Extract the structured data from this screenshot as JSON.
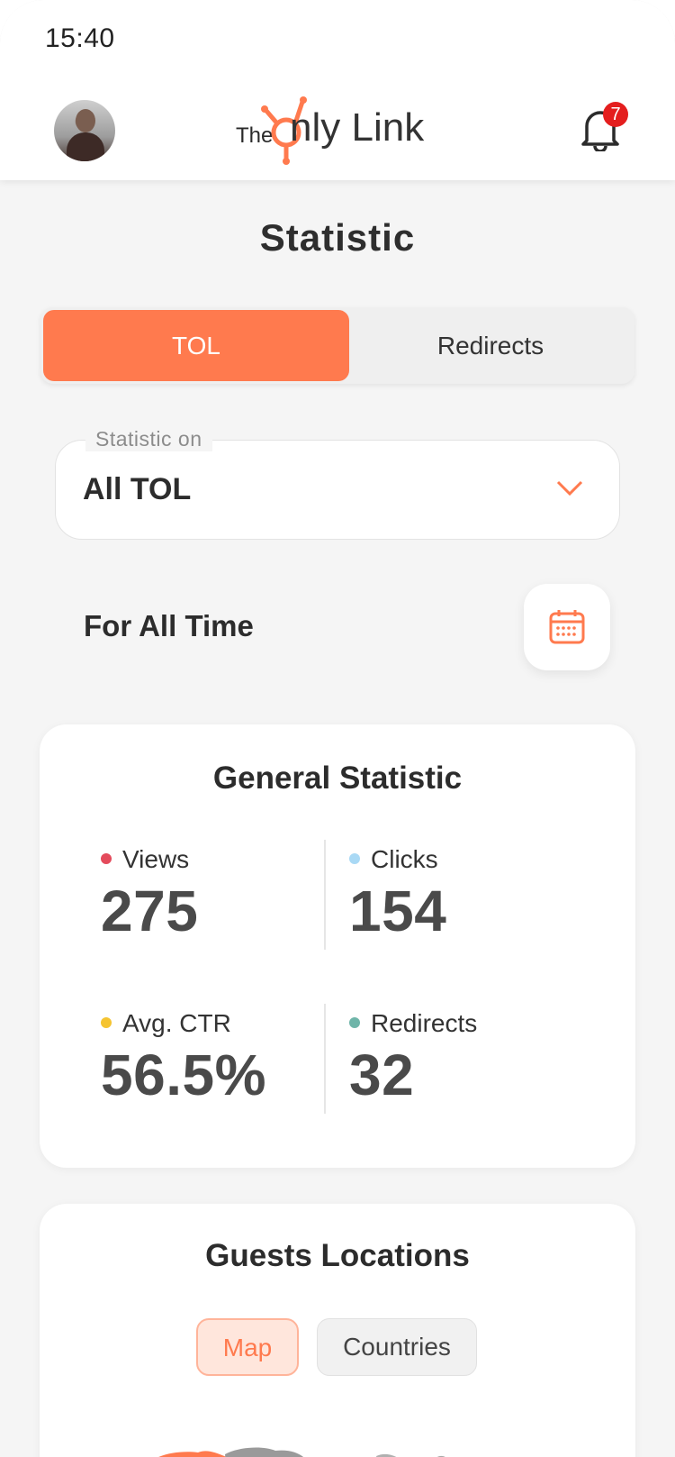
{
  "status_bar": {
    "time": "15:40"
  },
  "header": {
    "logo_the": "The",
    "logo_only": "nly Link",
    "notifications_count": "7",
    "brand_color": "#ff7a4e"
  },
  "page": {
    "title": "Statistic"
  },
  "tabs": [
    {
      "label": "TOL",
      "active": true
    },
    {
      "label": "Redirects",
      "active": false
    }
  ],
  "filter": {
    "legend": "Statistic on",
    "value": "All TOL"
  },
  "period": {
    "label": "For All Time"
  },
  "general": {
    "title": "General Statistic",
    "stats": [
      {
        "label": "Views",
        "value": "275",
        "color": "#e44b5c"
      },
      {
        "label": "Clicks",
        "value": "154",
        "color": "#a9d9f5"
      },
      {
        "label": "Avg. CTR",
        "value": "56.5%",
        "color": "#f5c431"
      },
      {
        "label": "Redirects",
        "value": "32",
        "color": "#6fb5a9"
      }
    ]
  },
  "locations": {
    "title": "Guests Locations",
    "toggle": [
      {
        "label": "Map",
        "active": true
      },
      {
        "label": "Countries",
        "active": false
      }
    ]
  }
}
